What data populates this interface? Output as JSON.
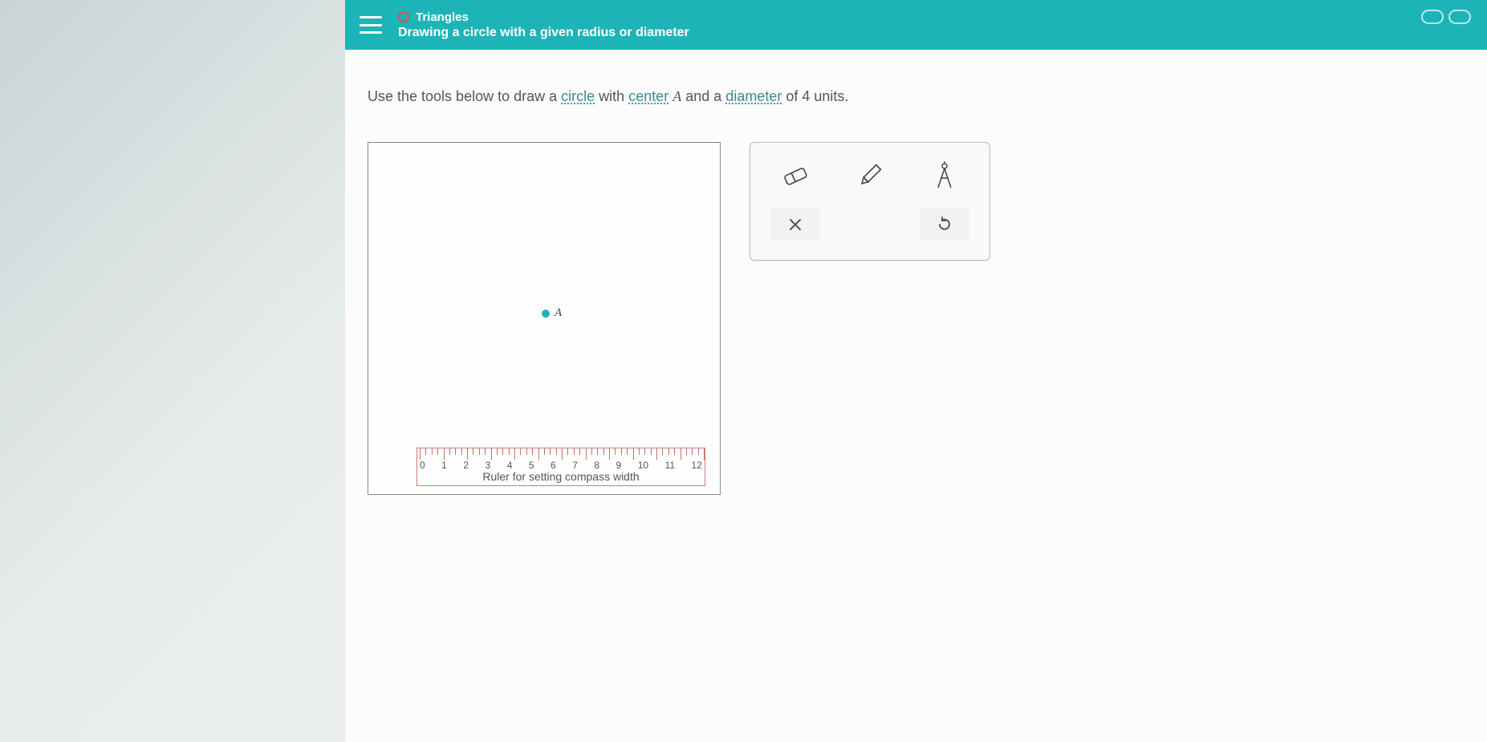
{
  "header": {
    "category": "Triangles",
    "lesson_title": "Drawing a circle with a given radius or diameter"
  },
  "instruction": {
    "prefix": "Use the tools below to draw a ",
    "term_circle": "circle",
    "mid1": " with ",
    "term_center": "center",
    "point_name": " A",
    "mid2": " and a ",
    "term_diameter": "diameter",
    "suffix_a": " of ",
    "value": "4",
    "suffix_b": " units."
  },
  "canvas": {
    "point_label": "A"
  },
  "ruler": {
    "numbers": [
      "0",
      "1",
      "2",
      "3",
      "4",
      "5",
      "6",
      "7",
      "8",
      "9",
      "10",
      "11",
      "12"
    ],
    "caption": "Ruler for setting compass width"
  },
  "tools": {
    "eraser": "eraser",
    "pencil": "pencil",
    "compass": "compass",
    "clear": "clear",
    "undo": "undo"
  }
}
